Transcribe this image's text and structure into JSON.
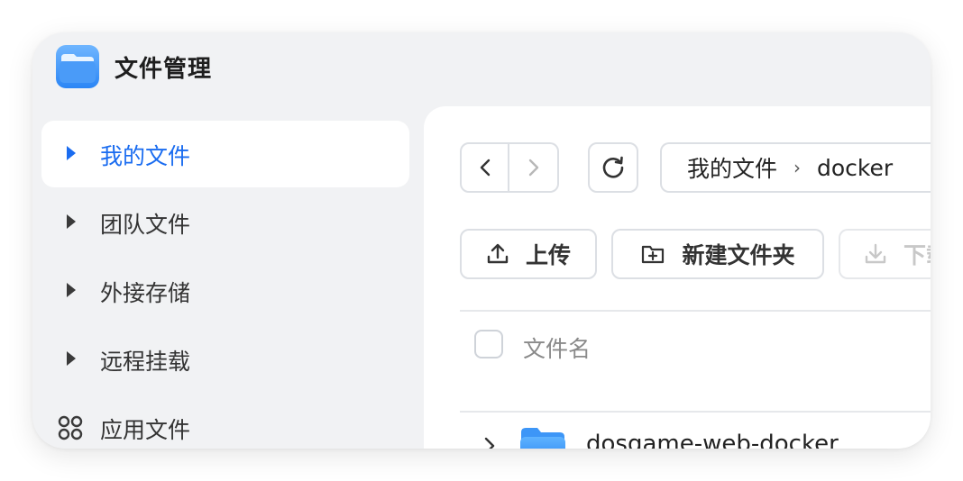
{
  "app": {
    "title": "文件管理",
    "icon": "folder-app-icon",
    "accent": "#1a6cf0"
  },
  "sidebar": {
    "items": [
      {
        "label": "我的文件",
        "icon": "caret-right-icon",
        "active": true
      },
      {
        "label": "团队文件",
        "icon": "caret-right-icon",
        "active": false
      },
      {
        "label": "外接存储",
        "icon": "caret-right-icon",
        "active": false
      },
      {
        "label": "远程挂载",
        "icon": "caret-right-icon",
        "active": false
      },
      {
        "label": "应用文件",
        "icon": "apps-grid-icon",
        "active": false
      }
    ]
  },
  "nav": {
    "back_icon": "chevron-left-icon",
    "forward_icon": "chevron-right-icon",
    "refresh_icon": "refresh-icon"
  },
  "breadcrumb": {
    "items": [
      "我的文件",
      "docker"
    ],
    "separator": "›"
  },
  "toolbar": {
    "upload_label": "上传",
    "new_folder_label": "新建文件夹",
    "download_label": "下载"
  },
  "table": {
    "column_name": "文件名",
    "rows": [
      {
        "name": "dosgame-web-docker",
        "type": "folder"
      }
    ]
  }
}
